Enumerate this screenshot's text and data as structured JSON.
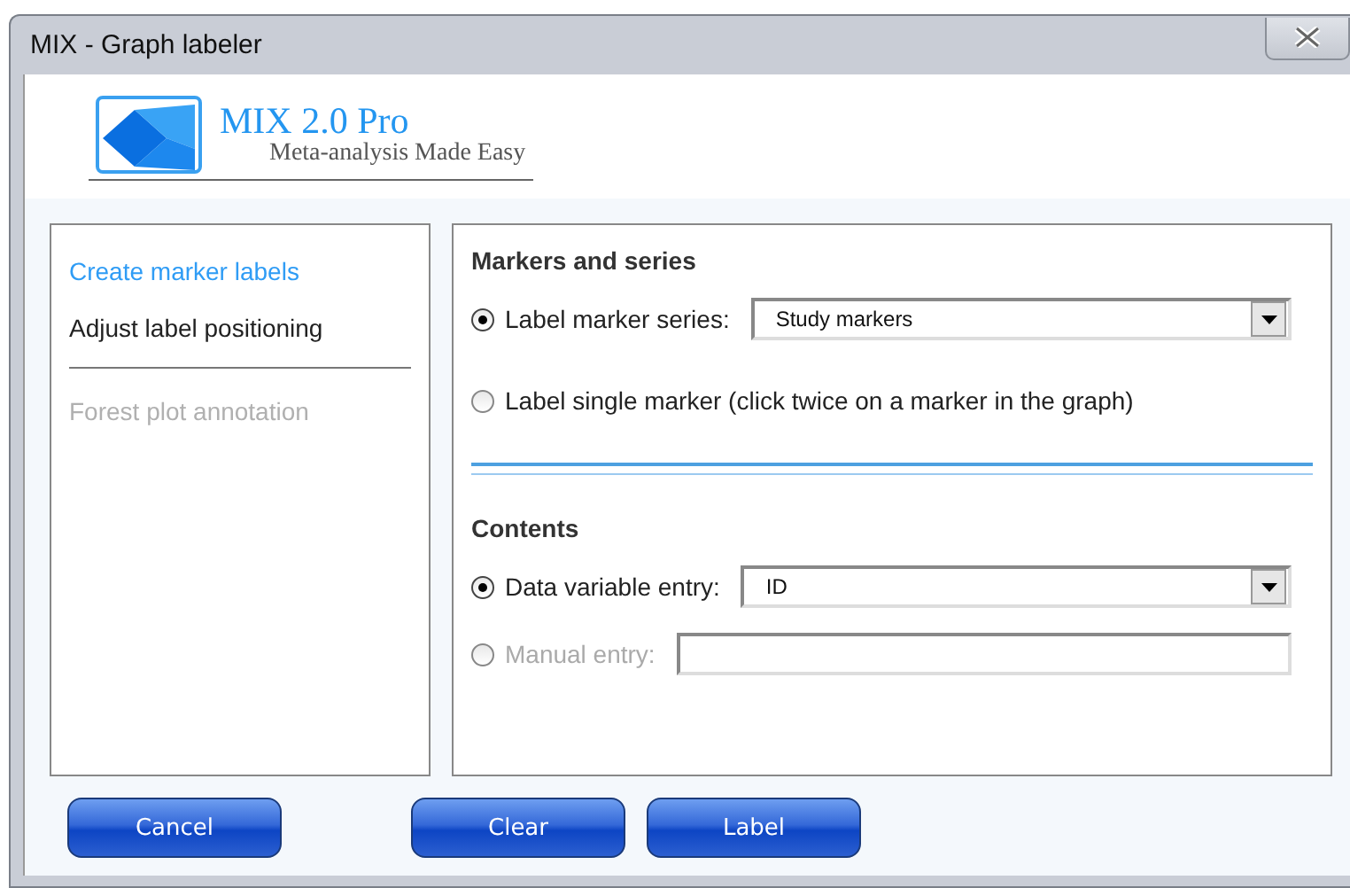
{
  "window": {
    "title": "MIX - Graph labeler"
  },
  "header": {
    "product": "MIX 2.0 Pro",
    "tagline": "Meta-analysis Made Easy"
  },
  "nav_groups": [
    [
      {
        "label": "Create marker labels",
        "selected": true,
        "disabled": false
      },
      {
        "label": "Adjust label positioning",
        "selected": false,
        "disabled": false
      }
    ],
    [
      {
        "label": "Forest plot annotation",
        "selected": false,
        "disabled": true
      }
    ]
  ],
  "sections": [
    {
      "title": "Markers and series",
      "options": [
        {
          "kind": "dropdown",
          "label": "Label marker series:",
          "selected": true,
          "disabled": false,
          "value": "Study markers"
        },
        {
          "kind": "plain",
          "label": "Label single marker (click twice on a marker in the graph)",
          "selected": false,
          "disabled": false
        }
      ]
    },
    {
      "title": "Contents",
      "options": [
        {
          "kind": "dropdown",
          "label": "Data variable entry:",
          "selected": true,
          "disabled": false,
          "value": "ID"
        },
        {
          "kind": "text",
          "label": "Manual entry:",
          "selected": false,
          "disabled": true
        }
      ]
    }
  ],
  "buttons": [
    "Cancel",
    "Clear",
    "Label"
  ]
}
